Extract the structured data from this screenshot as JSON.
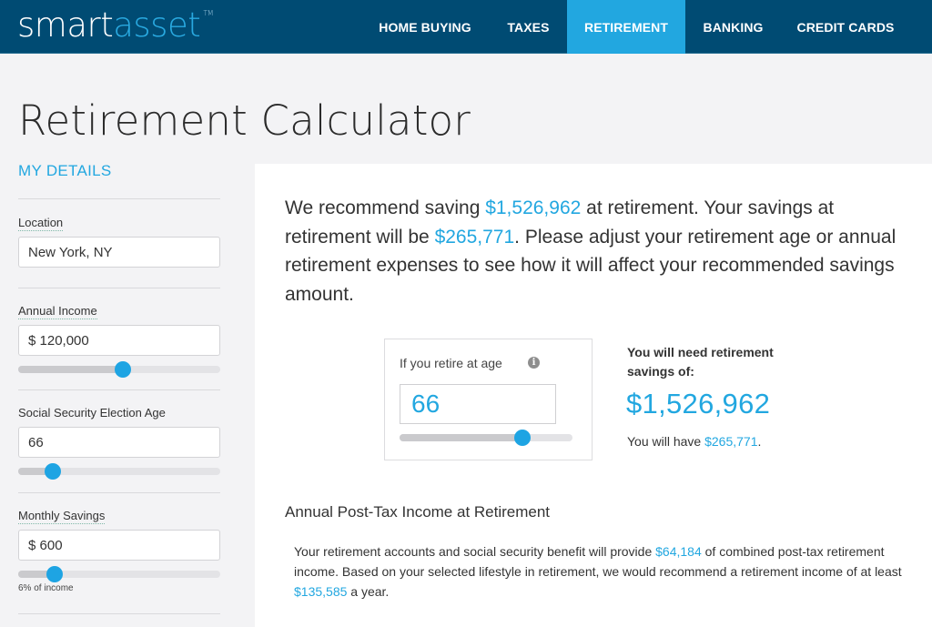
{
  "header": {
    "logo": {
      "part1": "smart",
      "part2": "asset",
      "tm": "TM"
    },
    "nav": [
      {
        "label": "HOME BUYING",
        "active": false
      },
      {
        "label": "TAXES",
        "active": false
      },
      {
        "label": "RETIREMENT",
        "active": true
      },
      {
        "label": "BANKING",
        "active": false
      },
      {
        "label": "CREDIT CARDS",
        "active": false
      }
    ]
  },
  "page_title": "Retirement Calculator",
  "sidebar": {
    "heading": "MY DETAILS",
    "location": {
      "label": "Location",
      "value": "New York, NY"
    },
    "annual_income": {
      "label": "Annual Income",
      "value": "$ 120,000",
      "slider_percent": 52
    },
    "ss_age": {
      "label": "Social Security Election Age",
      "value": "66",
      "slider_percent": 17
    },
    "monthly_savings": {
      "label": "Monthly Savings",
      "value": "$ 600",
      "slider_percent": 18,
      "note": "6% of income"
    }
  },
  "main": {
    "headline": {
      "p1": "We recommend saving ",
      "amount1": "$1,526,962",
      "p2": " at retirement. Your savings at retirement will be ",
      "amount2": "$265,771",
      "p3": ". Please adjust your retirement age or annual retirement expenses to see how it will affect your recommended savings amount."
    },
    "retire_age": {
      "label": "If you retire at age",
      "info_icon": "i",
      "value": "66",
      "slider_percent": 71
    },
    "need": {
      "label": "You will need retirement savings of:",
      "amount": "$1,526,962",
      "have_prefix": "You will have ",
      "have_amount": "$265,771",
      "have_suffix": "."
    },
    "income_section": {
      "heading": "Annual Post-Tax Income at Retirement",
      "p1": "Your retirement accounts and social security benefit will provide ",
      "amount1": "$64,184",
      "p2": " of combined post-tax retirement income. Based on your selected lifestyle in retirement, we would recommend a retirement income of at least ",
      "amount2": "$135,585",
      "p3": " a year."
    }
  },
  "colors": {
    "nav_bg": "#004b73",
    "accent": "#22a7e0",
    "page_bg": "#f3f3f5"
  }
}
